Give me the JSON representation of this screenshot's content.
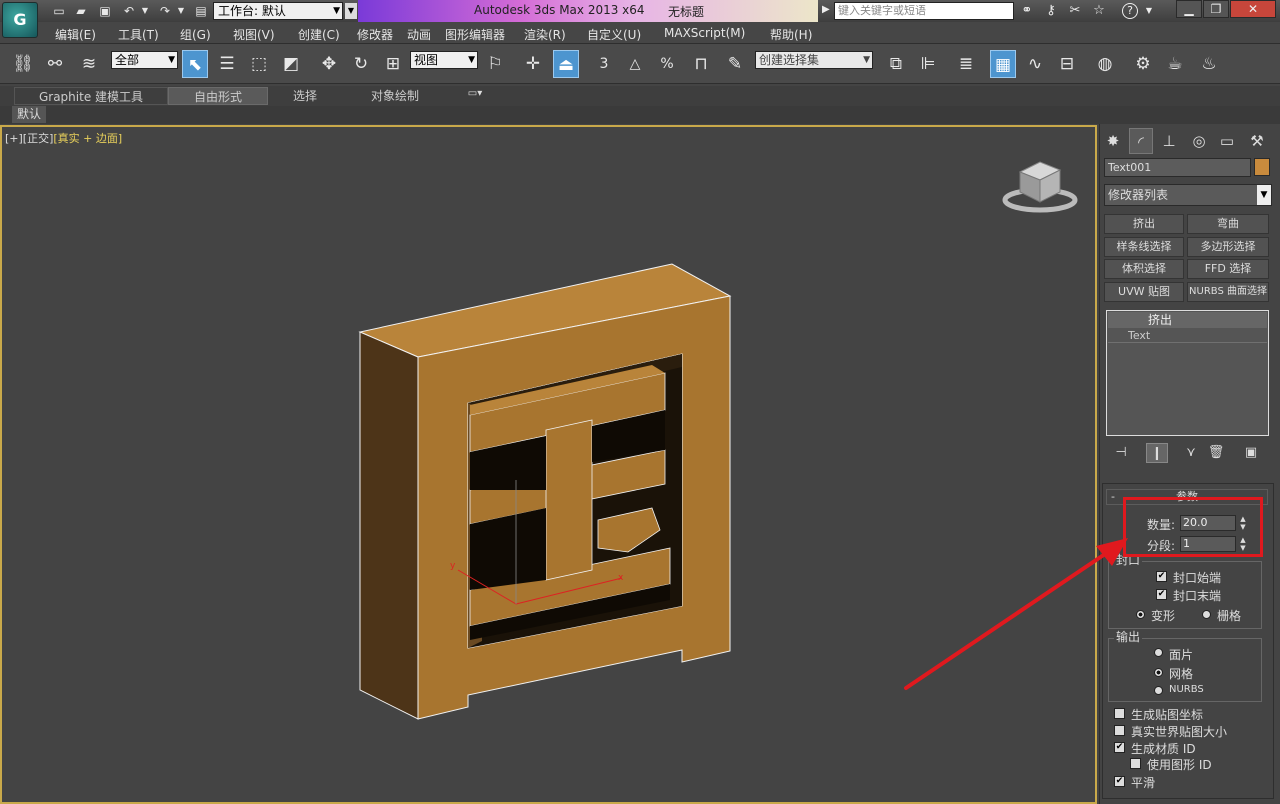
{
  "titlebar": {
    "logo": "G",
    "workspace_label": "工作台: 默认",
    "app_title": "Autodesk 3ds Max  2013 x64",
    "file_name": "无标题",
    "search_placeholder": "键入关键字或短语"
  },
  "menu": [
    "编辑(E)",
    "工具(T)",
    "组(G)",
    "视图(V)",
    "创建(C)",
    "修改器",
    "动画",
    "图形编辑器",
    "渲染(R)",
    "自定义(U)",
    "MAXScript(M)",
    "帮助(H)"
  ],
  "toolbar": {
    "filter_value": "全部",
    "ref_coord_value": "视图",
    "selection_set_placeholder": "创建选择集",
    "snap_label": "3",
    "angle_snap_label": "△",
    "percent_label": "%"
  },
  "ribbon": {
    "tabs": [
      "Graphite 建模工具",
      "自由形式",
      "选择",
      "对象绘制"
    ],
    "sub_label": "默认"
  },
  "viewport": {
    "label_prefix": "[+][正交]",
    "label_shading": "[真实 + 边面]",
    "axis_x": "x",
    "axis_y": "y",
    "object_colors": {
      "front": "#a8752f",
      "top": "#b9843a",
      "side": "#4d3418",
      "inner_shadow": "#1a1208"
    }
  },
  "command_panel": {
    "object_name": "Text001",
    "object_color": "#c98b3d",
    "modifier_list": "修改器列表",
    "modifier_buttons": [
      "挤出",
      "弯曲",
      "样条线选择",
      "多边形选择",
      "体积选择",
      "FFD 选择",
      "UVW 贴图",
      "NURBS 曲面选择"
    ],
    "stack": {
      "top": "挤出",
      "base": "Text"
    },
    "rollout_title": "参数",
    "amount_label": "数量:",
    "amount_value": "20.0",
    "segments_label": "分段:",
    "segments_value": "1",
    "capping_title": "封口",
    "cap_start": "封口始端",
    "cap_end": "封口末端",
    "morph": "变形",
    "grid": "栅格",
    "output_title": "输出",
    "patch": "面片",
    "mesh": "网格",
    "nurbs": "NURBS",
    "gen_map_coords": "生成贴图坐标",
    "real_world_map": "真实世界贴图大小",
    "gen_mat_ids": "生成材质 ID",
    "use_shape_ids": "使用图形 ID",
    "smooth": "平滑"
  },
  "annotation": {
    "color": "#e0191e"
  }
}
